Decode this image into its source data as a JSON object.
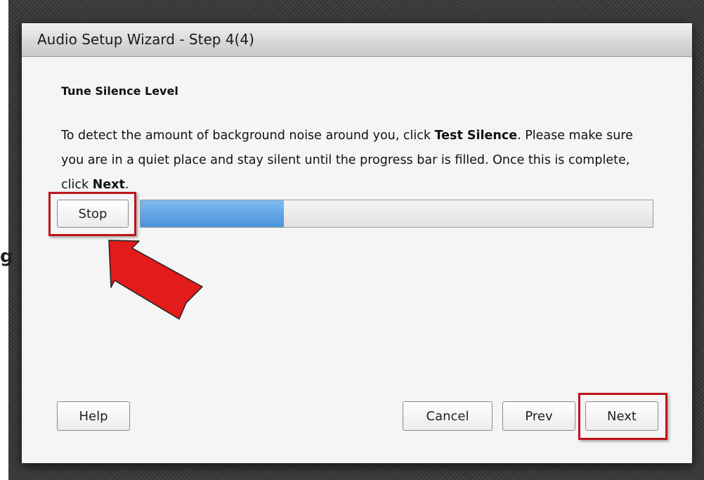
{
  "background": {
    "partial_text": "g"
  },
  "dialog": {
    "title": "Audio Setup Wizard - Step 4(4)",
    "heading": "Tune Silence Level",
    "instructions": {
      "part1": "To detect the amount of background noise around you, click ",
      "bold1": "Test Silence",
      "part2": ". Please make sure you are in a quiet place and stay silent until the progress bar is filled. Once this is complete, click ",
      "bold2": "Next",
      "part3": "."
    },
    "stop_label": "Stop",
    "progress_fraction": 0.28,
    "help_label": "Help",
    "cancel_label": "Cancel",
    "prev_label": "Prev",
    "next_label": "Next"
  },
  "annotations": {
    "highlight_color": "#c0141b",
    "arrow_color": "#e21b1b",
    "progress_color": "#4a94dc"
  }
}
